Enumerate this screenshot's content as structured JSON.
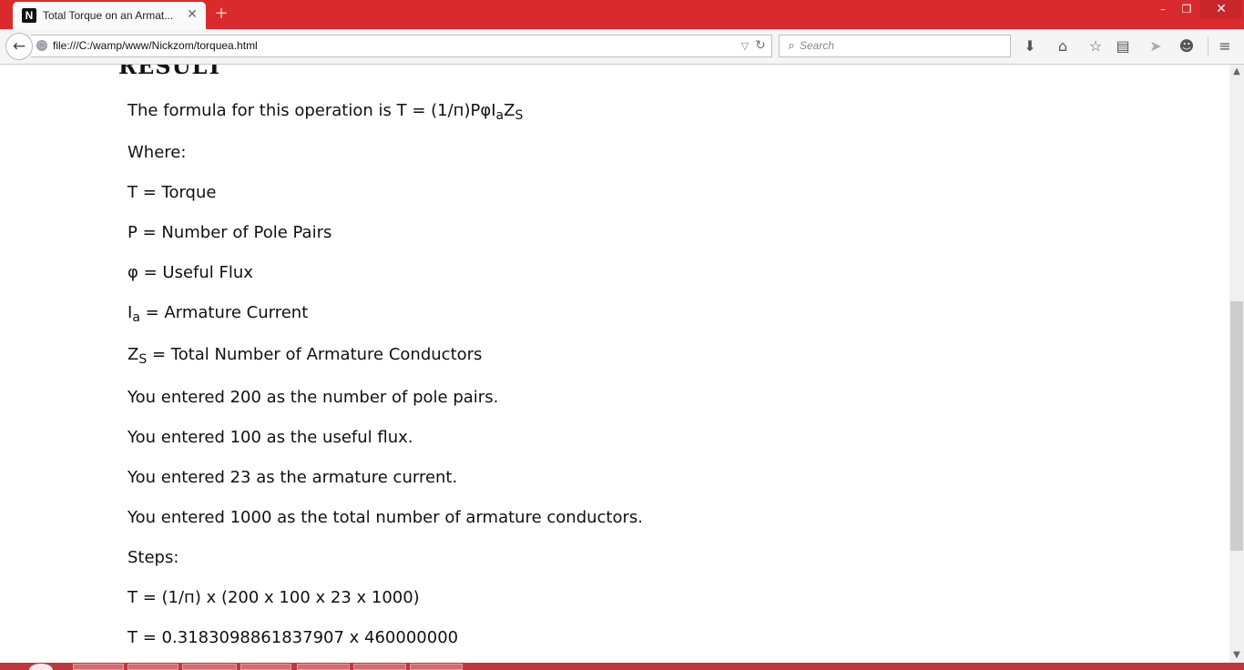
{
  "browser": {
    "tab": {
      "title": "Total Torque on an Armat...",
      "favicon": "N",
      "close": "✕"
    },
    "new_tab": "+",
    "window_controls": {
      "minimize": "–",
      "maximize": "❐",
      "close": "✕"
    },
    "nav": {
      "back": "←",
      "url": "file:///C:/wamp/www/Nickzom/torquea.html"
    },
    "search": {
      "placeholder": "Search"
    },
    "toolbar_icons": [
      "download-icon",
      "home-icon",
      "bookmark-star-icon",
      "reading-list-icon",
      "share-icon",
      "chat-icon",
      "menu-icon"
    ]
  },
  "page": {
    "heading": "RESULT",
    "formula": {
      "prefix": "The formula for this operation is T = (1/п)Pφ",
      "i": "I",
      "i_sub": "a",
      "z": "Z",
      "z_sub": "S"
    },
    "where_label": "Where:",
    "definitions": {
      "t": "T = Torque",
      "p": "P = Number of Pole Pairs",
      "phi": "φ = Useful Flux",
      "ia": {
        "symbol": "I",
        "sub": "a",
        "text": " = Armature Current"
      },
      "zs": {
        "symbol": "Z",
        "sub": "S",
        "text": " = Total Number of Armature Conductors"
      }
    },
    "entries": [
      "You entered 200 as the number of pole pairs.",
      "You entered 100 as the useful flux.",
      "You entered 23 as the armature current.",
      "You entered 1000 as the total number of armature conductors."
    ],
    "steps_label": "Steps:",
    "steps": [
      "T = (1/п) x (200 x 100 x 23 x 1000)",
      "T = 0.3183098861837907 x 460000000"
    ]
  },
  "colors": {
    "titlebar": "#d92b2e",
    "taskbar": "#c0373b",
    "text": "#111111"
  }
}
